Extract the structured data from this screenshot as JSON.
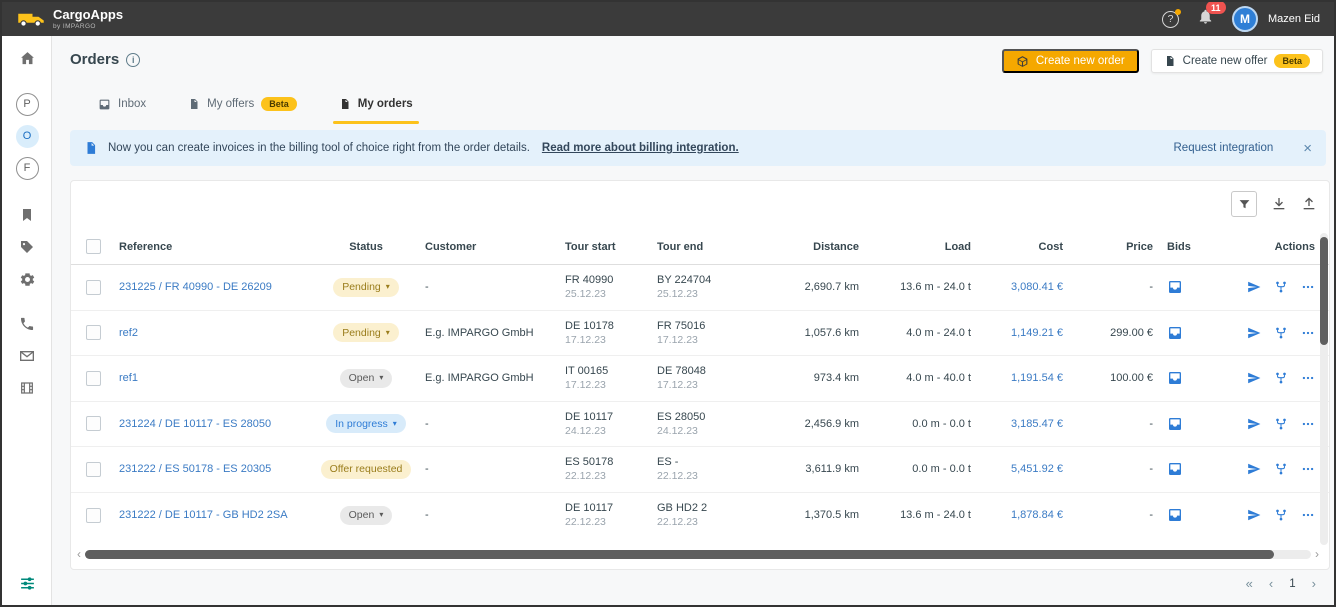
{
  "colors": {
    "topbar_bg": "#3b3b3b",
    "accent_yellow": "#fcc21b",
    "button_orange": "#f5a800",
    "link_blue": "#3b7bc4",
    "action_blue": "#2e7cd6",
    "banner_bg": "#e4f1fb",
    "banner_text": "#33475b",
    "badge_red": "#ef5350",
    "avatar_blue": "#2f7fd6",
    "sidebar_active_bg": "#d9edfb"
  },
  "icons": {
    "help": "question-circle",
    "notifications": "bell",
    "create_order": "package",
    "create_offer": "document",
    "banner": "invoice-document",
    "filter": "funnel",
    "export": "download-tray",
    "import": "upload-tray",
    "bids": "inbox-tray",
    "send": "paper-plane",
    "share": "fork",
    "more": "ellipsis"
  },
  "topbar": {
    "app_name": "CargoApps",
    "app_subtitle": "by IMPARGO",
    "help_label": "?",
    "notification_count": "11",
    "user_initial": "M",
    "user_name": "Mazen Eid"
  },
  "sidebar": {
    "items": [
      {
        "label": "P"
      },
      {
        "label": "O"
      },
      {
        "label": "F"
      }
    ]
  },
  "page": {
    "title": "Orders",
    "info": "i",
    "create_order": "Create new order",
    "create_offer": "Create new offer",
    "beta": "Beta"
  },
  "tabs": {
    "inbox": "Inbox",
    "offers": "My offers",
    "offers_badge": "Beta",
    "orders": "My orders"
  },
  "banner": {
    "text": "Now you can create invoices in the billing tool of choice right from the order details.",
    "link": "Read more about billing integration.",
    "action": "Request integration",
    "close": "×"
  },
  "table": {
    "headers": {
      "reference": "Reference",
      "status": "Status",
      "customer": "Customer",
      "tour_start": "Tour start",
      "tour_end": "Tour end",
      "distance": "Distance",
      "load": "Load",
      "cost": "Cost",
      "price": "Price",
      "bids": "Bids",
      "actions": "Actions"
    },
    "rows": [
      {
        "reference": "231225 / FR 40990 - DE 26209",
        "status": "Pending",
        "status_type": "pending",
        "customer": "-",
        "tour_start_loc": "FR 40990",
        "tour_start_date": "25.12.23",
        "tour_end_loc": "BY 224704",
        "tour_end_date": "25.12.23",
        "distance": "2,690.7 km",
        "load": "13.6 m - 24.0 t",
        "cost": "3,080.41 €",
        "price": "-"
      },
      {
        "reference": "ref2",
        "status": "Pending",
        "status_type": "pending",
        "customer": "E.g. IMPARGO GmbH",
        "tour_start_loc": "DE 10178",
        "tour_start_date": "17.12.23",
        "tour_end_loc": "FR 75016",
        "tour_end_date": "17.12.23",
        "distance": "1,057.6 km",
        "load": "4.0 m - 24.0 t",
        "cost": "1,149.21 €",
        "price": "299.00 €"
      },
      {
        "reference": "ref1",
        "status": "Open",
        "status_type": "open",
        "customer": "E.g. IMPARGO GmbH",
        "tour_start_loc": "IT 00165",
        "tour_start_date": "17.12.23",
        "tour_end_loc": "DE 78048",
        "tour_end_date": "17.12.23",
        "distance": "973.4 km",
        "load": "4.0 m - 40.0 t",
        "cost": "1,191.54 €",
        "price": "100.00 €"
      },
      {
        "reference": "231224 / DE 10117 - ES 28050",
        "status": "In progress",
        "status_type": "in-progress",
        "customer": "-",
        "tour_start_loc": "DE 10117",
        "tour_start_date": "24.12.23",
        "tour_end_loc": "ES 28050",
        "tour_end_date": "24.12.23",
        "distance": "2,456.9 km",
        "load": "0.0 m - 0.0 t",
        "cost": "3,185.47 €",
        "price": "-"
      },
      {
        "reference": "231222 / ES 50178 - ES 20305",
        "status": "Offer requested",
        "status_type": "offer-requested",
        "customer": "-",
        "tour_start_loc": "ES 50178",
        "tour_start_date": "22.12.23",
        "tour_end_loc": "ES -",
        "tour_end_date": "22.12.23",
        "distance": "3,611.9 km",
        "load": "0.0 m - 0.0 t",
        "cost": "5,451.92 €",
        "price": "-"
      },
      {
        "reference": "231222 / DE 10117 - GB HD2 2SA",
        "status": "Open",
        "status_type": "open",
        "customer": "-",
        "tour_start_loc": "DE 10117",
        "tour_start_date": "22.12.23",
        "tour_end_loc": "GB HD2 2",
        "tour_end_date": "22.12.23",
        "distance": "1,370.5 km",
        "load": "13.6 m - 24.0 t",
        "cost": "1,878.84 €",
        "price": "-"
      }
    ]
  },
  "scrollbar": {
    "left_arrow": "‹",
    "right_arrow": "›"
  },
  "pagination": {
    "first": "«",
    "prev": "‹",
    "page": "1",
    "next": "›"
  }
}
